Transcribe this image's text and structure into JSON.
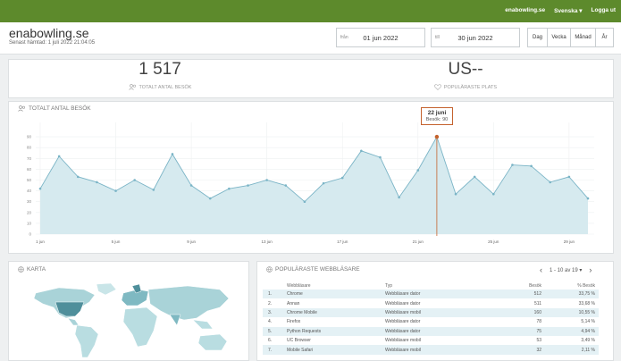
{
  "topnav": {
    "site": "enabowling.se",
    "language": "Svenska ▾",
    "logout": "Logga ut"
  },
  "header": {
    "title": "enabowling.se",
    "subtitle": "Senast hämtad: 1 juli 2022 21:04:05"
  },
  "date_range": {
    "from_label": "från",
    "from_value": "01 jun 2022",
    "to_label": "till",
    "to_value": "30 jun 2022"
  },
  "periods": [
    "Dag",
    "Vecka",
    "Månad",
    "År"
  ],
  "kpis": {
    "visits_value": "1 517",
    "visits_label": "TOTALT ANTAL BESÖK",
    "place_value": "US--",
    "place_label": "POPULÄRASTE PLATS"
  },
  "chart_title": "TOTALT ANTAL BESÖK",
  "tooltip": {
    "date": "22 juni",
    "value": "Besök: 90"
  },
  "chart_data": {
    "type": "area",
    "title": "TOTALT ANTAL BESÖK",
    "x": [
      1,
      2,
      3,
      4,
      5,
      6,
      7,
      8,
      9,
      10,
      11,
      12,
      13,
      14,
      15,
      16,
      17,
      18,
      19,
      20,
      21,
      22,
      23,
      24,
      25,
      26,
      27,
      28,
      29,
      30
    ],
    "values": [
      42,
      72,
      53,
      48,
      40,
      50,
      41,
      74,
      45,
      33,
      42,
      45,
      50,
      45,
      30,
      47,
      52,
      77,
      71,
      34,
      59,
      90,
      37,
      53,
      37,
      64,
      63,
      48,
      53,
      33
    ],
    "xticks": [
      "1 jun",
      "5 jun",
      "9 jun",
      "13 jun",
      "17 jun",
      "21 jun",
      "25 jun",
      "29 jun"
    ],
    "xtick_days": [
      1,
      5,
      9,
      13,
      17,
      21,
      25,
      29
    ],
    "yticks": [
      0,
      10,
      20,
      30,
      40,
      50,
      60,
      70,
      80,
      90
    ],
    "ylim": [
      0,
      100
    ],
    "highlight_day": 22,
    "color": "#7ab4c6"
  },
  "map_title": "KARTA",
  "browsers": {
    "title": "POPULÄRASTE WEBBLÄSARE",
    "pager": "1 - 10 av 19",
    "columns": [
      "",
      "Webbläsare",
      "Typ",
      "Besök",
      "% Besök"
    ],
    "rows": [
      [
        "1.",
        "Chrome",
        "Webbläsare dator",
        "512",
        "33,75 %"
      ],
      [
        "2.",
        "Annan",
        "Webbläsare dator",
        "511",
        "33,68 %"
      ],
      [
        "3.",
        "Chrome Mobile",
        "Webbläsare mobil",
        "160",
        "10,55 %"
      ],
      [
        "4.",
        "Firefox",
        "Webbläsare dator",
        "78",
        "5,14 %"
      ],
      [
        "5.",
        "Python Requests",
        "Webbläsare dator",
        "75",
        "4,94 %"
      ],
      [
        "6.",
        "UC Browser",
        "Webbläsare mobil",
        "53",
        "3,49 %"
      ],
      [
        "7.",
        "Mobile Safari",
        "Webbläsare mobil",
        "32",
        "2,11 %"
      ]
    ]
  }
}
